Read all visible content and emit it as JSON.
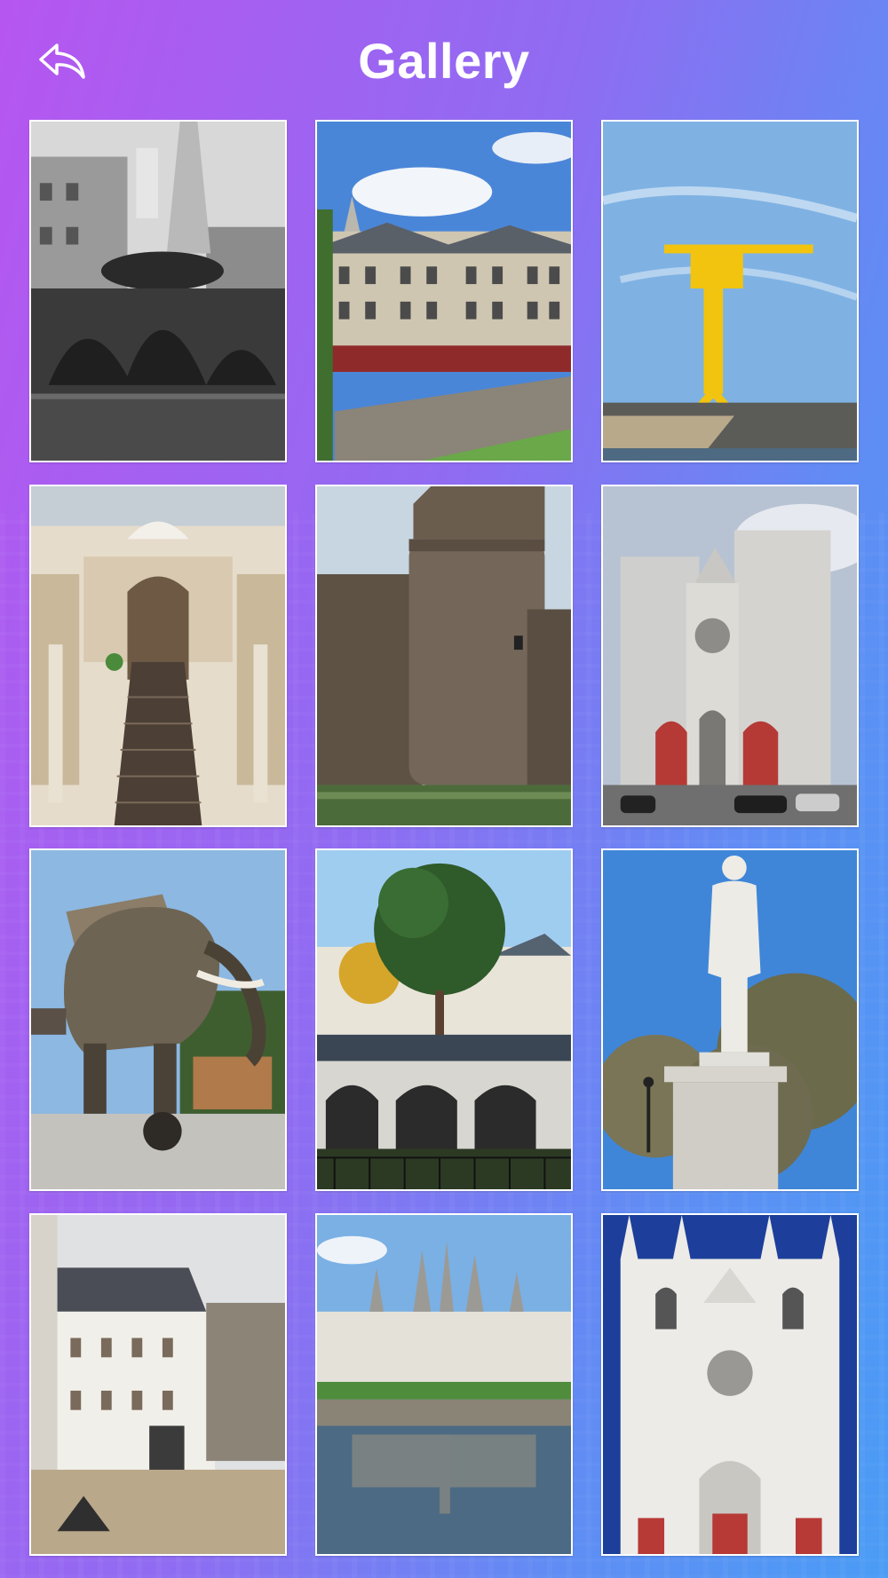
{
  "header": {
    "title": "Gallery",
    "back_icon": "undo-arrow-icon"
  },
  "gallery": {
    "photos": [
      {
        "subject": "fountain"
      },
      {
        "subject": "buildings"
      },
      {
        "subject": "yellow-crane"
      },
      {
        "subject": "arcade-passage"
      },
      {
        "subject": "castle-tower"
      },
      {
        "subject": "cathedral"
      },
      {
        "subject": "mechanical-elephant"
      },
      {
        "subject": "tree-arcade"
      },
      {
        "subject": "statue"
      },
      {
        "subject": "castle-courtyard"
      },
      {
        "subject": "chateau"
      },
      {
        "subject": "cathedral-facade"
      }
    ]
  },
  "colors": {
    "gradient_start": "#b656f0",
    "gradient_end": "#4a9cf5",
    "tile_border": "#ffffff",
    "title": "#ffffff"
  }
}
